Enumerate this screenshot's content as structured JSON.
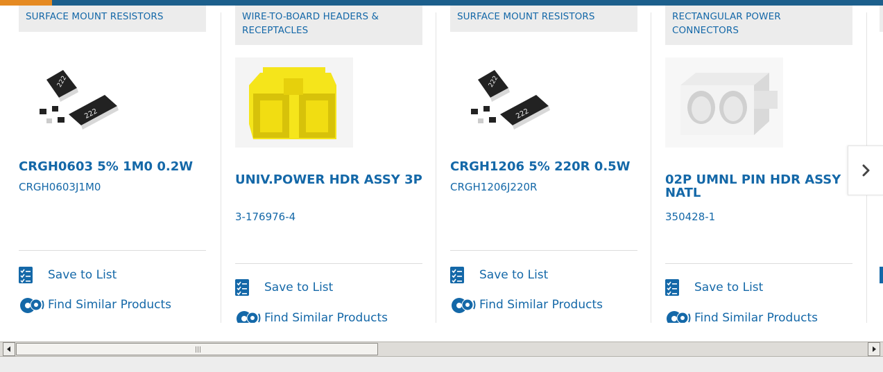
{
  "colors": {
    "accent": "#e58a22",
    "brand": "#1c5f8c",
    "link": "#1468a8"
  },
  "cards": [
    {
      "category": "SURFACE MOUNT RESISTORS",
      "title": "CRGH0603 5% 1M0 0.2W",
      "part_number": "CRGH0603J1M0",
      "image": "smd-resistor-chips",
      "save_label": "Save to List",
      "find_label": "Find Similar Products"
    },
    {
      "category": "WIRE-TO-BOARD HEADERS & RECEPTACLES",
      "title": "UNIV.POWER HDR ASSY 3P",
      "part_number": "3-176976-4",
      "image": "yellow-header-connector",
      "save_label": "Save to List",
      "find_label": "Find Similar Products"
    },
    {
      "category": "SURFACE MOUNT RESISTORS",
      "title": "CRGH1206 5% 220R 0.5W",
      "part_number": "CRGH1206J220R",
      "image": "smd-resistor-chips",
      "save_label": "Save to List",
      "find_label": "Find Similar Products"
    },
    {
      "category": "RECTANGULAR POWER CONNECTORS",
      "title": "02P UMNL PIN HDR ASSY NATL",
      "part_number": "350428-1",
      "image": "white-power-connector",
      "save_label": "Save to List",
      "find_label": "Find Similar Products"
    }
  ],
  "icons": {
    "save": "checklist-icon",
    "find": "gears-icon",
    "next": "chevron-right-icon"
  }
}
